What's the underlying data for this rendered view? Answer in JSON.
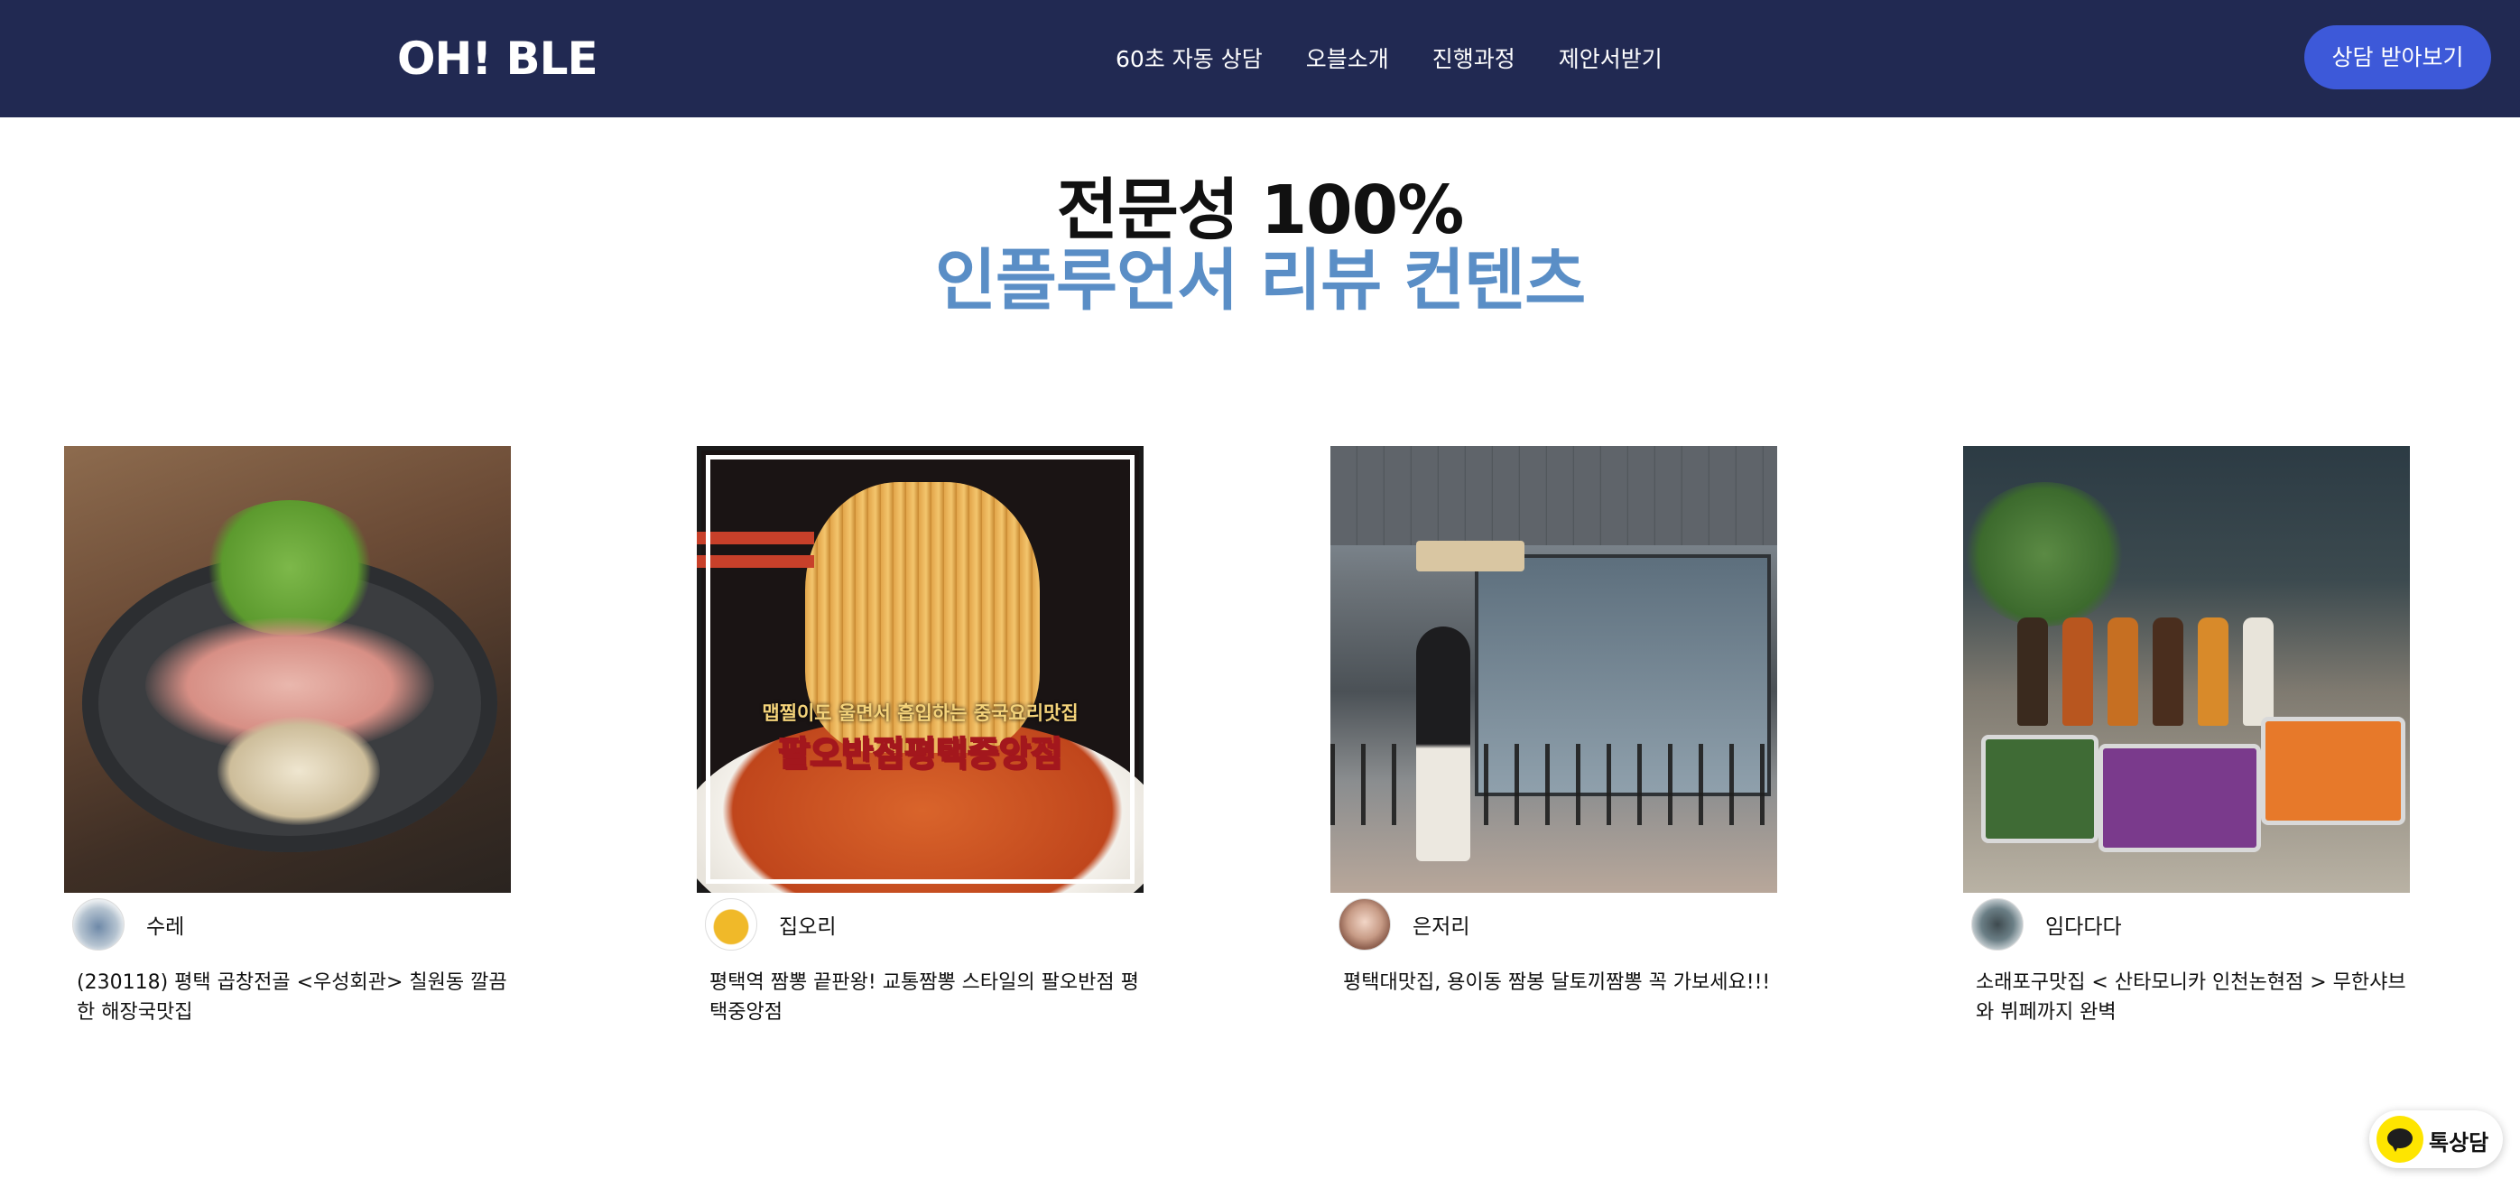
{
  "header": {
    "logo": "OH! BLE",
    "nav": [
      "60초 자동 상담",
      "오블소개",
      "진행과정",
      "제안서받기"
    ],
    "cta_label": "상담 받아보기"
  },
  "hero": {
    "line1": "전문성 100%",
    "line2": "인플루언서 리뷰 컨텐츠"
  },
  "reviews": [
    {
      "author": "수레",
      "title": "(230118) 평택 곱창전골 <우성회관> 칠원동 깔끔한 해장국맛집"
    },
    {
      "author": "집오리",
      "title": "평택역 짬뽕 끝판왕! 교통짬뽕 스타일의 팔오반점 평택중앙점",
      "photo_caption_sub": "맵찔이도 울면서 흡입하는 중국요리맛집",
      "photo_caption_main": "팔오반점평택중앙점"
    },
    {
      "author": "은저리",
      "title": "평택대맛집, 용이동 짬봉 달토끼짬뽕 꼭 가보세요!!!"
    },
    {
      "author": "임다다다",
      "title": "소래포구맛집 < 산타모니카 인천논현점 > 무한샤브와 뷔페까지 완벽"
    }
  ],
  "chat": {
    "label": "톡상담"
  },
  "colors": {
    "header_bg": "#212952",
    "cta_bg": "#3d59d9",
    "accent_blue": "#5a8ec6",
    "chat_yellow": "#fee500"
  }
}
